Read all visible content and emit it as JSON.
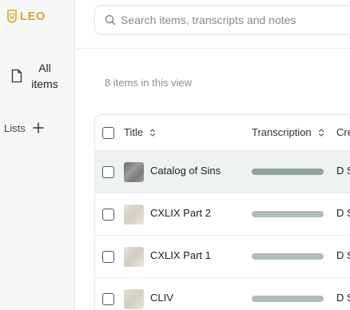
{
  "sidebar": {
    "logo_text": "LEO",
    "nav_all_items": "All items",
    "lists_label": "Lists"
  },
  "search": {
    "placeholder": "Search items, transcripts and notes"
  },
  "count_text": "8 items in this view",
  "table": {
    "columns": [
      "Title",
      "Transcription",
      "Cre"
    ],
    "rows": [
      {
        "title": "Catalog of Sins",
        "creator": "D S",
        "bar_color": "#8fa3a0",
        "thumb": "dark"
      },
      {
        "title": "CXLIX Part 2",
        "creator": "D S",
        "bar_color": "#aebcba",
        "thumb": "light"
      },
      {
        "title": "CXLIX Part 1",
        "creator": "D S",
        "bar_color": "#aebcba",
        "thumb": "light"
      },
      {
        "title": "CLIV",
        "creator": "D S",
        "bar_color": "#aebcba",
        "thumb": "light"
      }
    ]
  },
  "colors": {
    "brand": "#d9a72a",
    "selected_row": "#eef2f1"
  }
}
